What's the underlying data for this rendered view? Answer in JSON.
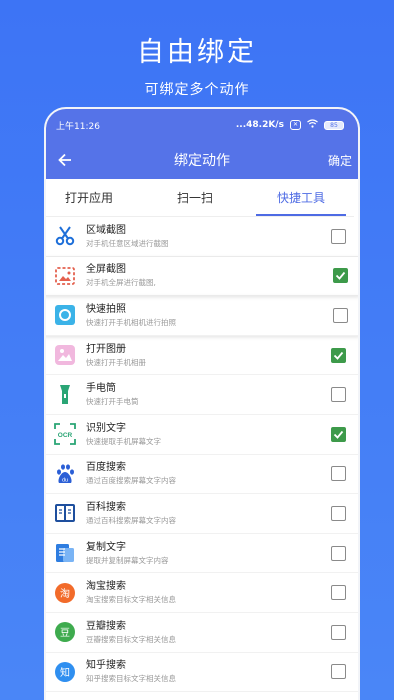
{
  "promo": {
    "title": "自由绑定",
    "subtitle": "可绑定多个动作"
  },
  "status_bar": {
    "time": "上午11:26",
    "speed": "...48.2K/s",
    "battery": "85"
  },
  "app_bar": {
    "title": "绑定动作",
    "confirm_label": "确定"
  },
  "tabs": [
    {
      "label": "打开应用",
      "active": false
    },
    {
      "label": "扫一扫",
      "active": false
    },
    {
      "label": "快捷工具",
      "active": true
    }
  ],
  "items": [
    {
      "title": "区域截图",
      "desc": "对手机任意区域进行截图",
      "checked": false,
      "icon": "scissors-icon"
    },
    {
      "title": "全屏截图",
      "desc": "对手机全屏进行截图,",
      "checked": true,
      "icon": "image-icon"
    },
    {
      "title": "快速拍照",
      "desc": "快速打开手机相机进行拍照",
      "checked": false,
      "icon": "camera-icon"
    },
    {
      "title": "打开图册",
      "desc": "快速打开手机相册",
      "checked": true,
      "icon": "gallery-icon"
    },
    {
      "title": "手电筒",
      "desc": "快速打开手电筒",
      "checked": false,
      "icon": "flashlight-icon"
    },
    {
      "title": "识别文字",
      "desc": "快速提取手机屏幕文字",
      "checked": true,
      "icon": "ocr-icon"
    },
    {
      "title": "百度搜索",
      "desc": "通过百度搜索屏幕文字内容",
      "checked": false,
      "icon": "baidu-icon"
    },
    {
      "title": "百科搜索",
      "desc": "通过百科搜索屏幕文字内容",
      "checked": false,
      "icon": "book-icon"
    },
    {
      "title": "复制文字",
      "desc": "提取并复制屏幕文字内容",
      "checked": false,
      "icon": "copy-icon"
    },
    {
      "title": "淘宝搜索",
      "desc": "淘宝搜索目标文字相关信息",
      "checked": false,
      "icon": "taobao-icon"
    },
    {
      "title": "豆瓣搜索",
      "desc": "豆瓣搜索目标文字相关信息",
      "checked": false,
      "icon": "douban-icon"
    },
    {
      "title": "知乎搜索",
      "desc": "知乎搜索目标文字相关信息",
      "checked": false,
      "icon": "zhihu-icon"
    },
    {
      "title": "",
      "desc": "",
      "checked": false,
      "icon": "more-icon"
    }
  ],
  "colors": {
    "accent": "#5573e8",
    "check": "#3d9a4a",
    "background": "#3d74f5"
  }
}
